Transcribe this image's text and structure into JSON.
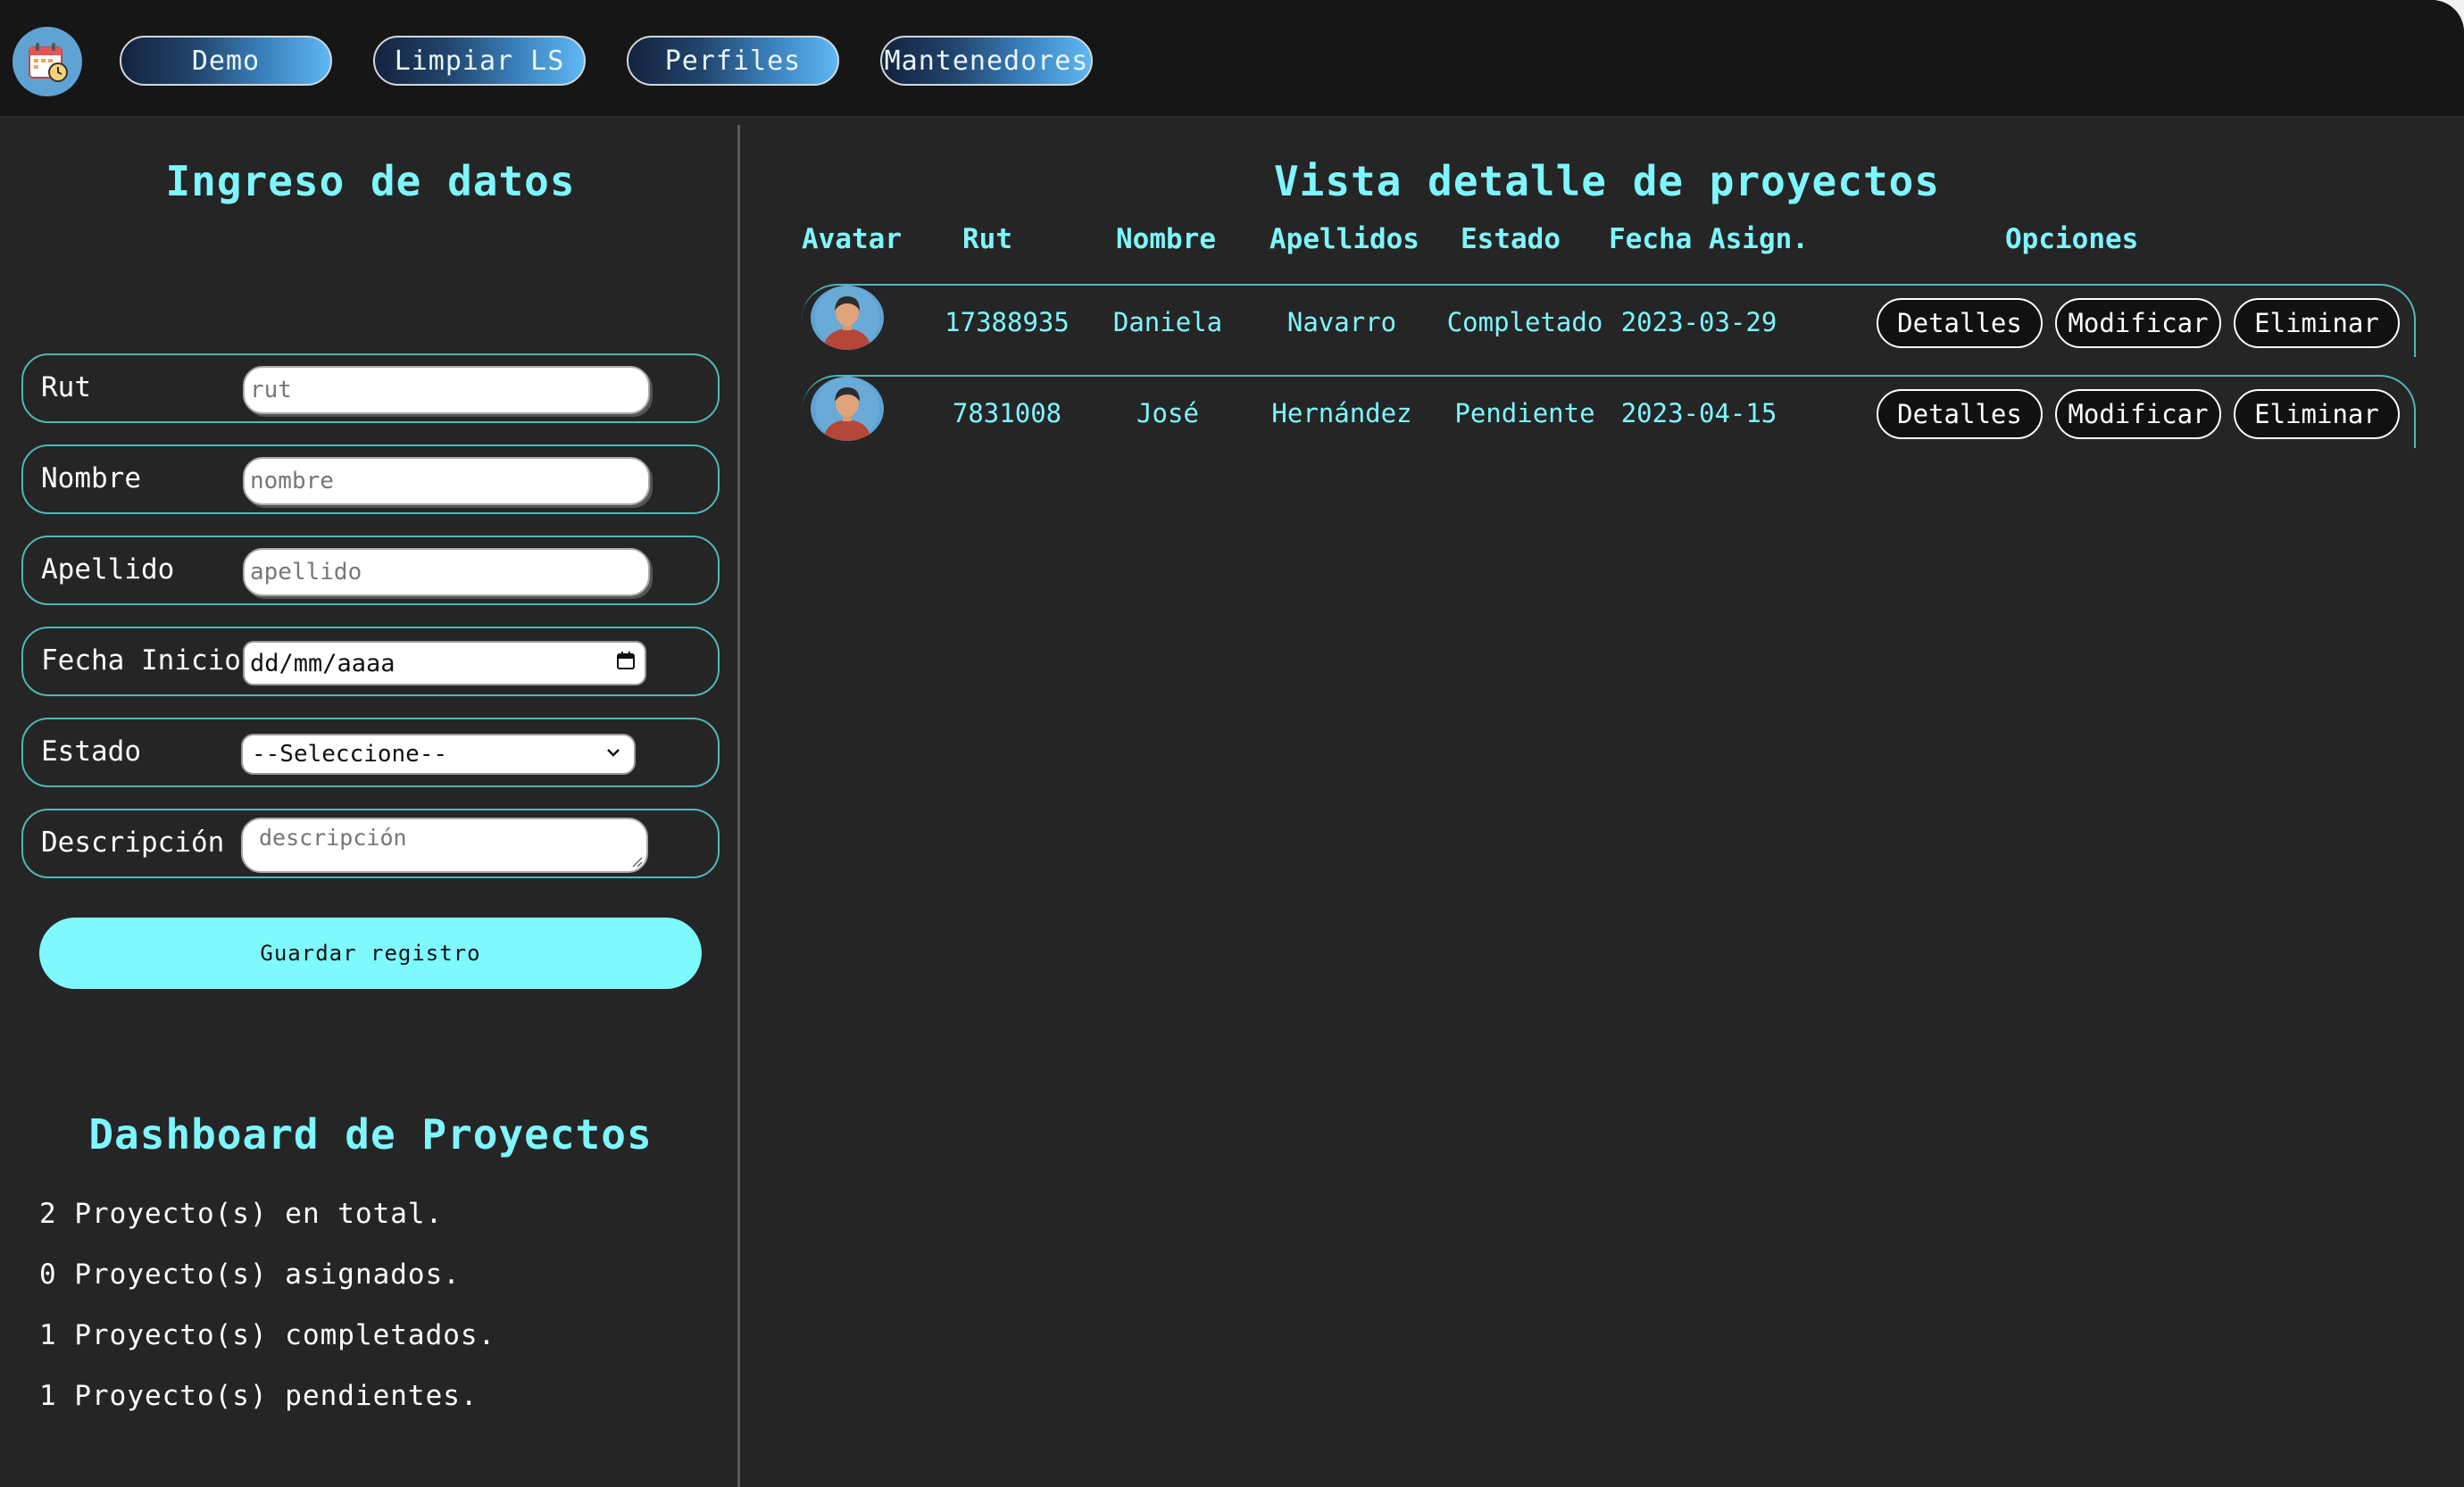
{
  "nav": {
    "buttons": [
      "Demo",
      "Limpiar LS",
      "Perfiles",
      "Mantenedores"
    ]
  },
  "form": {
    "title": "Ingreso de datos",
    "fields": [
      {
        "label": "Rut",
        "placeholder": "rut"
      },
      {
        "label": "Nombre",
        "placeholder": "nombre"
      },
      {
        "label": "Apellido",
        "placeholder": "apellido"
      },
      {
        "label": "Fecha Inicio",
        "value": "dd/mm/aaaa"
      },
      {
        "label": "Estado",
        "value": "--Seleccione--"
      },
      {
        "label": "Descripción",
        "placeholder": "descripción"
      }
    ],
    "save_label": "Guardar registro"
  },
  "dashboard": {
    "title": "Dashboard de Proyectos",
    "lines": [
      "2 Proyecto(s) en total.",
      "0 Proyecto(s) asignados.",
      "1 Proyecto(s) completados.",
      "1 Proyecto(s) pendientes."
    ]
  },
  "table": {
    "title": "Vista detalle de proyectos",
    "headers": [
      "Avatar",
      "Rut",
      "Nombre",
      "Apellidos",
      "Estado",
      "Fecha Asign.",
      "Opciones"
    ],
    "rows": [
      {
        "rut": "17388935",
        "nombre": "Daniela",
        "apellidos": "Navarro",
        "estado": "Completado",
        "fecha": "2023-03-29"
      },
      {
        "rut": "7831008",
        "nombre": "José",
        "apellidos": "Hernández",
        "estado": "Pendiente",
        "fecha": "2023-04-15"
      }
    ],
    "actions": [
      "Detalles",
      "Modificar",
      "Eliminar"
    ]
  },
  "colors": {
    "accent": "#7ef6fd",
    "background": "#252526",
    "border": "#4fb8b6"
  },
  "icons": [
    "calendar-clock-icon",
    "user-avatar-icon",
    "calendar-icon",
    "chevron-down-icon"
  ]
}
